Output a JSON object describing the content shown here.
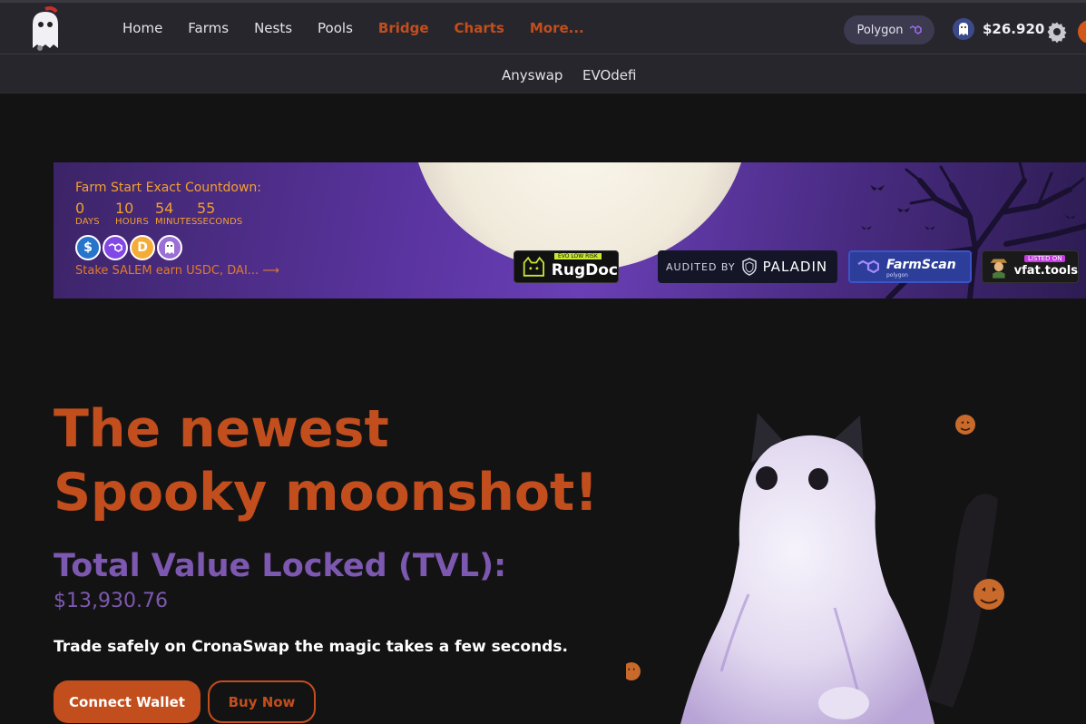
{
  "nav": {
    "items": [
      {
        "label": "Home"
      },
      {
        "label": "Farms"
      },
      {
        "label": "Nests"
      },
      {
        "label": "Pools"
      },
      {
        "label": "Bridge"
      },
      {
        "label": "Charts"
      },
      {
        "label": "More..."
      }
    ],
    "network": "Polygon",
    "token_price": "$26.920"
  },
  "subnav": {
    "items": [
      {
        "label": "Anyswap"
      },
      {
        "label": "EVOdefi"
      }
    ]
  },
  "banner": {
    "countdown_title": "Farm Start Exact Countdown:",
    "countdown": [
      {
        "value": "0",
        "unit": "DAYS"
      },
      {
        "value": "10",
        "unit": "HOURS"
      },
      {
        "value": "54",
        "unit": "MINUTES"
      },
      {
        "value": "55",
        "unit": "SECONDS"
      }
    ],
    "stake_link": "Stake SALEM earn USDC, DAI... ⟶",
    "badges": {
      "rugdoc_tag": "EVO LOW RISK",
      "rugdoc": "RugDoc",
      "paladin_prefix": "AUDITED BY",
      "paladin": "PALADIN",
      "farmscan": "FarmScan",
      "farmscan_sub": "polygon",
      "vfat_tag": "LISTED ON",
      "vfat": "vfat.tools"
    }
  },
  "hero": {
    "title": "The newest Spooky moonshot!",
    "tvl_label": "Total Value Locked (TVL):",
    "tvl_value": "$13,930.76",
    "tagline": "Trade safely on CronaSwap the magic takes a few seconds.",
    "connect_button": "Connect Wallet",
    "buy_button": "Buy Now"
  },
  "colors": {
    "accent": "#c24e1d",
    "purple": "#7d58b0",
    "countdown": "#f3a02b"
  }
}
